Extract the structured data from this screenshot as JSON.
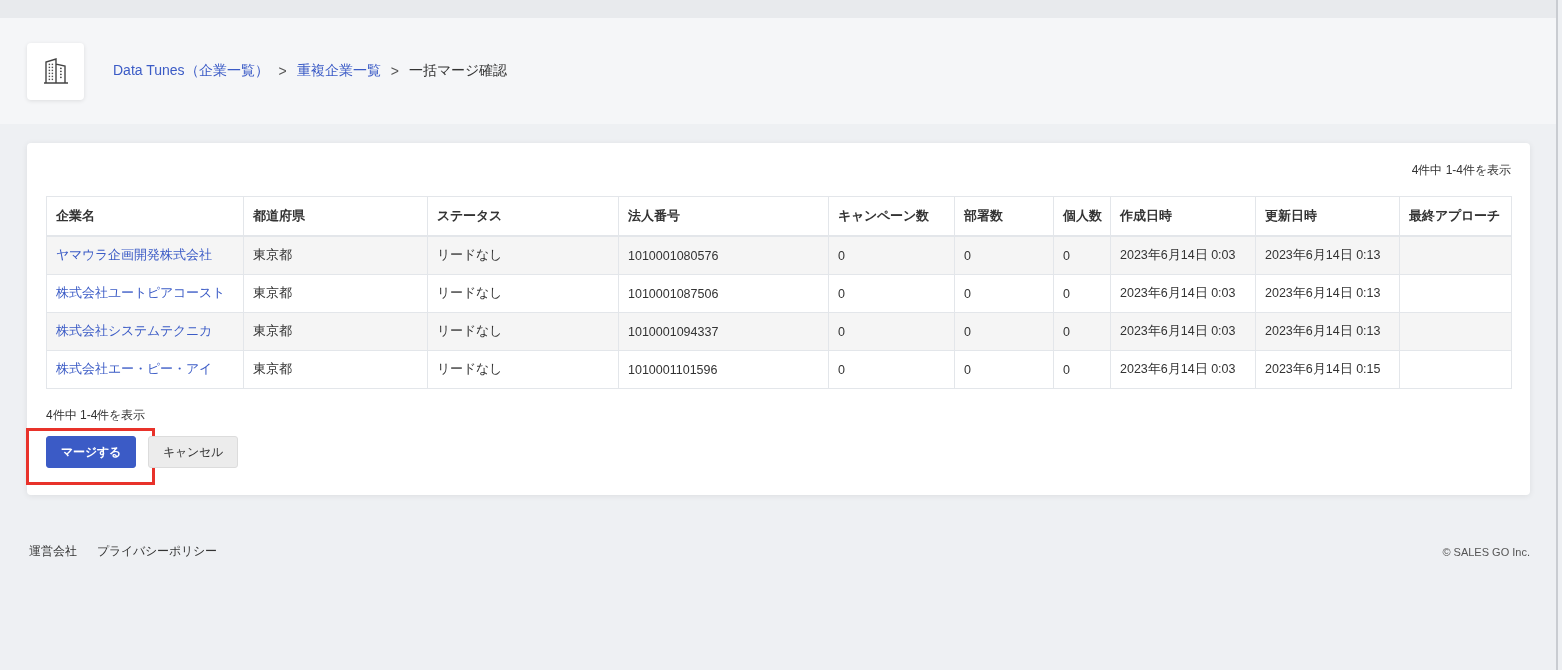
{
  "breadcrumb": [
    {
      "label": "Data Tunes（企業一覧）",
      "link": true
    },
    {
      "label": "重複企業一覧",
      "link": true
    },
    {
      "label": "一括マージ確認",
      "link": false
    }
  ],
  "breadcrumb_separator": ">",
  "result_count_top": "4件中 1-4件を表示",
  "table": {
    "columns": [
      "企業名",
      "都道府県",
      "ステータス",
      "法人番号",
      "キャンペーン数",
      "部署数",
      "個人数",
      "作成日時",
      "更新日時",
      "最終アプローチ"
    ],
    "rows": [
      {
        "cells": [
          "ヤマウラ企画開発株式会社",
          "東京都",
          "リードなし",
          "1010001080576",
          "0",
          "0",
          "0",
          "2023年6月14日 0:03",
          "2023年6月14日 0:13",
          ""
        ]
      },
      {
        "cells": [
          "株式会社ユートピアコースト",
          "東京都",
          "リードなし",
          "1010001087506",
          "0",
          "0",
          "0",
          "2023年6月14日 0:03",
          "2023年6月14日 0:13",
          ""
        ]
      },
      {
        "cells": [
          "株式会社システムテクニカ",
          "東京都",
          "リードなし",
          "1010001094337",
          "0",
          "0",
          "0",
          "2023年6月14日 0:03",
          "2023年6月14日 0:13",
          ""
        ]
      },
      {
        "cells": [
          "株式会社エー・ピー・アイ",
          "東京都",
          "リードなし",
          "1010001101596",
          "0",
          "0",
          "0",
          "2023年6月14日 0:03",
          "2023年6月14日 0:15",
          ""
        ]
      }
    ]
  },
  "result_count_bottom": "4件中 1-4件を表示",
  "buttons": [
    {
      "label": "マージする",
      "kind": "primary",
      "highlighted": true
    },
    {
      "label": "キャンセル",
      "kind": "secondary",
      "highlighted": false
    }
  ],
  "footer": {
    "links": [
      "運営会社",
      "プライバシーポリシー"
    ],
    "copyright": "© SALES GO Inc."
  }
}
